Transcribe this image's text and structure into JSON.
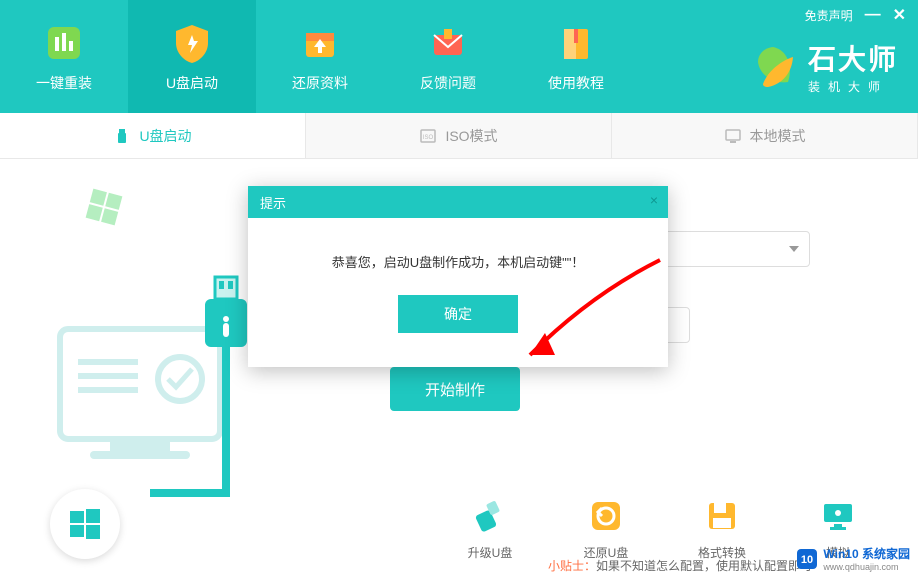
{
  "titlebar": {
    "disclaimer": "免责声明"
  },
  "nav": {
    "items": [
      {
        "label": "一键重装"
      },
      {
        "label": "U盘启动"
      },
      {
        "label": "还原资料"
      },
      {
        "label": "反馈问题"
      },
      {
        "label": "使用教程"
      }
    ]
  },
  "logo": {
    "big": "石大师",
    "sub": "装机大师"
  },
  "tabs": {
    "items": [
      {
        "label": "U盘启动"
      },
      {
        "label": "ISO模式"
      },
      {
        "label": "本地模式"
      }
    ]
  },
  "form": {
    "start_button": "开始制作"
  },
  "tip": {
    "prefix": "小贴士：",
    "text": "如果不知道怎么配置，使用默认配置即可"
  },
  "tools": {
    "items": [
      {
        "label": "升级U盘"
      },
      {
        "label": "还原U盘"
      },
      {
        "label": "格式转换"
      },
      {
        "label": "模拟"
      }
    ]
  },
  "dialog": {
    "title": "提示",
    "message": "恭喜您，启动U盘制作成功，本机启动键\"\"！",
    "ok": "确定"
  },
  "watermark": {
    "text": "Win10 系统家园",
    "url": "www.qdhuajin.com"
  },
  "colors": {
    "accent": "#1fc8c0",
    "orange": "#ff7043"
  }
}
